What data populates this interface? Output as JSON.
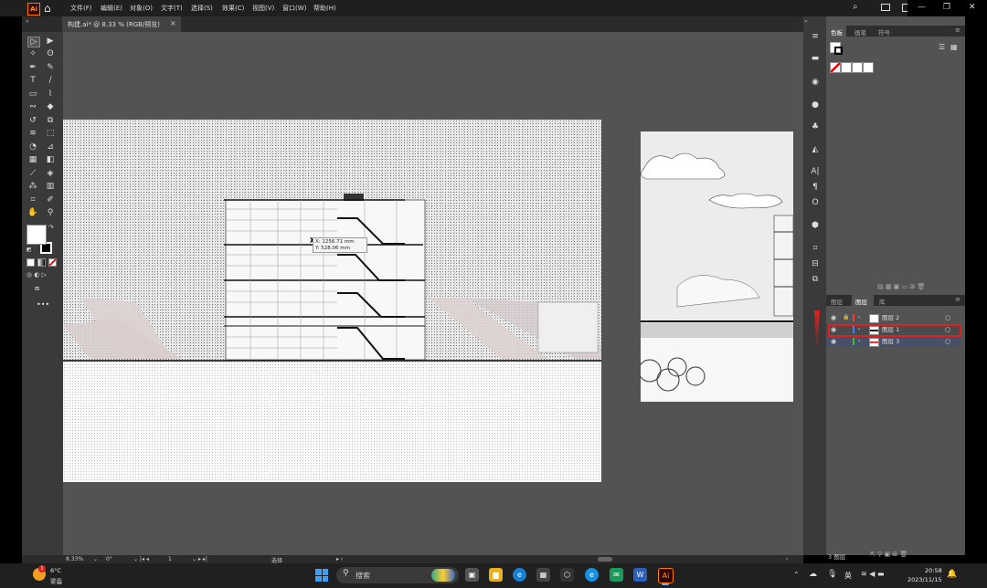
{
  "app": {
    "logo": "Ai",
    "menus": [
      "文件(F)",
      "编辑(E)",
      "对象(O)",
      "文字(T)",
      "选择(S)",
      "效果(C)",
      "视图(V)",
      "窗口(W)",
      "帮助(H)"
    ]
  },
  "document_tab": {
    "title": "构建.ai* @ 8.33 % (RGB/预览)",
    "close": "×"
  },
  "tooltip": {
    "x_line": "X: 1256.71 mm",
    "y_line": "Y: 528.06 mm"
  },
  "swatches_panel": {
    "tabs": [
      "色板",
      "画笔",
      "符号"
    ]
  },
  "layers_panel": {
    "tabs": [
      "图层",
      "图层",
      "库"
    ],
    "layers": [
      {
        "name": "图层 2",
        "color": "#ff3b3b"
      },
      {
        "name": "图层 1",
        "color": "#4a7cff"
      },
      {
        "name": "图层 3",
        "color": "#3bbf3b"
      }
    ],
    "footer": "3 图层"
  },
  "status_bar": {
    "zoom": "8.33%",
    "rotation": "0°",
    "page": "1",
    "tool": "选择"
  },
  "taskbar": {
    "weather_temp": "6°C",
    "weather_desc": "雾霾",
    "notification_count": "1",
    "search_placeholder": "搜索",
    "ime": "英",
    "time": "20:58",
    "date": "2023/11/15"
  },
  "colors": {
    "accent": "#ff9a00",
    "selection_outline": "#e02020"
  }
}
